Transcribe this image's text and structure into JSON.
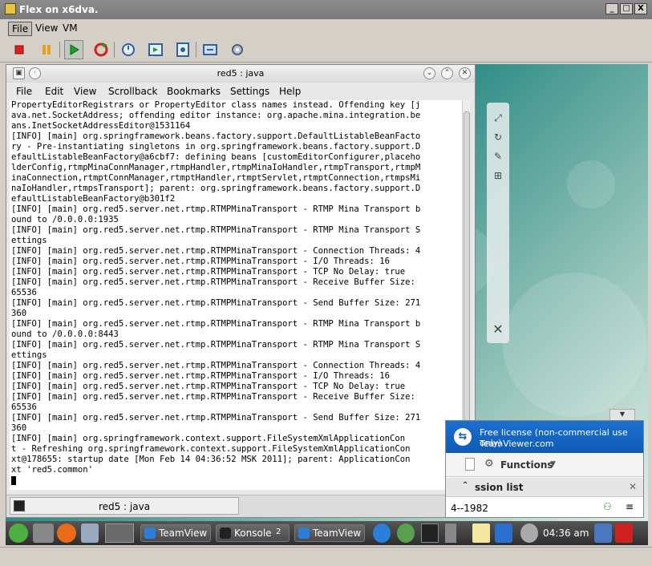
{
  "window": {
    "title": "Flex on x6dva."
  },
  "window_controls": {
    "minimize": "_",
    "maximize": "□",
    "close": "X"
  },
  "menubar": {
    "file": "File",
    "view": "View",
    "vm": "VM"
  },
  "toolbar": {
    "buttons": [
      "stop-icon",
      "pause-icon",
      "play-icon",
      "reset-icon",
      "snapshot-icon",
      "revert-snapshot-icon",
      "manage-snapshots-icon",
      "fullscreen-icon",
      "settings-icon"
    ]
  },
  "konsole": {
    "title": "red5 : java",
    "menu": [
      "File",
      "Edit",
      "View",
      "Scrollback",
      "Bookmarks",
      "Settings",
      "Help"
    ],
    "lines": [
      "PropertyEditorRegistrars or PropertyEditor class names instead. Offending key [j",
      "ava.net.SocketAddress; offending editor instance: org.apache.mina.integration.be",
      "ans.InetSocketAddressEditor@1531164",
      "[INFO] [main] org.springframework.beans.factory.support.DefaultListableBeanFacto",
      "ry - Pre-instantiating singletons in org.springframework.beans.factory.support.D",
      "efaultListableBeanFactory@a6cbf7: defining beans [customEditorConfigurer,placeho",
      "lderConfig,rtmpMinaConnManager,rtmpHandler,rtmpMinaIoHandler,rtmpTransport,rtmpM",
      "inaConnection,rtmptConnManager,rtmptHandler,rtmptServlet,rtmptConnection,rtmpsMi",
      "naIoHandler,rtmpsTransport]; parent: org.springframework.beans.factory.support.D",
      "efaultListableBeanFactory@b301f2",
      "[INFO] [main] org.red5.server.net.rtmp.RTMPMinaTransport - RTMP Mina Transport b",
      "ound to /0.0.0.0:1935",
      "[INFO] [main] org.red5.server.net.rtmp.RTMPMinaTransport - RTMP Mina Transport S",
      "ettings",
      "[INFO] [main] org.red5.server.net.rtmp.RTMPMinaTransport - Connection Threads: 4",
      "[INFO] [main] org.red5.server.net.rtmp.RTMPMinaTransport - I/O Threads: 16",
      "[INFO] [main] org.red5.server.net.rtmp.RTMPMinaTransport - TCP No Delay: true",
      "[INFO] [main] org.red5.server.net.rtmp.RTMPMinaTransport - Receive Buffer Size:",
      "65536",
      "[INFO] [main] org.red5.server.net.rtmp.RTMPMinaTransport - Send Buffer Size: 271",
      "360",
      "[INFO] [main] org.red5.server.net.rtmp.RTMPMinaTransport - RTMP Mina Transport b",
      "ound to /0.0.0.0:8443",
      "[INFO] [main] org.red5.server.net.rtmp.RTMPMinaTransport - RTMP Mina Transport S",
      "ettings",
      "[INFO] [main] org.red5.server.net.rtmp.RTMPMinaTransport - Connection Threads: 4",
      "[INFO] [main] org.red5.server.net.rtmp.RTMPMinaTransport - I/O Threads: 16",
      "[INFO] [main] org.red5.server.net.rtmp.RTMPMinaTransport - TCP No Delay: true",
      "[INFO] [main] org.red5.server.net.rtmp.RTMPMinaTransport - Receive Buffer Size:",
      "65536",
      "[INFO] [main] org.red5.server.net.rtmp.RTMPMinaTransport - Send Buffer Size: 271",
      "360",
      "[INFO] [main] org.springframework.context.support.FileSystemXmlApplicationCon",
      "t - Refreshing org.springframework.context.support.FileSystemXmlApplicationCon",
      "xt@178655: startup date [Mon Feb 14 04:36:52 MSK 2011]; parent: ApplicationCon",
      "xt 'red5.common'"
    ],
    "tab_label": "red5 : java"
  },
  "teamviewer": {
    "license_line1": "Free license (non-commercial use only)",
    "license_line2": "TeamViewer.com",
    "functions_label": "Functions",
    "session_list_label": "ssion list",
    "session_id": "4--1982"
  },
  "taskbar": {
    "tasks": [
      {
        "label": "TeamView",
        "icon_color": "#2a7fd8"
      },
      {
        "label": "Konsole",
        "icon_color": "#222222"
      },
      {
        "label": "TeamView",
        "icon_color": "#2a7fd8"
      }
    ],
    "konsole_count": "2",
    "clock": "04:36 am"
  },
  "colors": {
    "vm_chrome": "#d4d0c8",
    "kde_panel": "#3a3a3a",
    "teamviewer_blue": "#0f5bb5",
    "desktop": "#2b8a84"
  }
}
